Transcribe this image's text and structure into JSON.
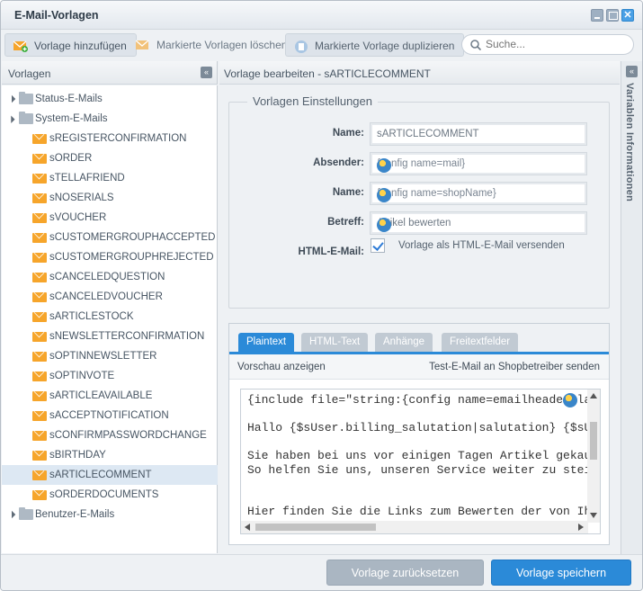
{
  "window": {
    "title": "E-Mail-Vorlagen"
  },
  "toolbar": {
    "add_label": "Vorlage hinzufügen",
    "delete_label": "Markierte Vorlagen löschen",
    "duplicate_label": "Markierte Vorlage duplizieren",
    "search_placeholder": "Suche..."
  },
  "left_panel": {
    "title": "Vorlagen",
    "folders": {
      "status": "Status-E-Mails",
      "system": "System-E-Mails",
      "user": "Benutzer-E-Mails"
    },
    "items": [
      "sREGISTERCONFIRMATION",
      "sORDER",
      "sTELLAFRIEND",
      "sNOSERIALS",
      "sVOUCHER",
      "sCUSTOMERGROUPHACCEPTED",
      "sCUSTOMERGROUPHREJECTED",
      "sCANCELEDQUESTION",
      "sCANCELEDVOUCHER",
      "sARTICLESTOCK",
      "sNEWSLETTERCONFIRMATION",
      "sOPTINNEWSLETTER",
      "sOPTINVOTE",
      "sARTICLEAVAILABLE",
      "sACCEPTNOTIFICATION",
      "sCONFIRMPASSWORDCHANGE",
      "sBIRTHDAY",
      "sARTICLECOMMENT",
      "sORDERDOCUMENTS"
    ],
    "selected": "sARTICLECOMMENT"
  },
  "editor": {
    "title": "Vorlage bearbeiten - sARTICLECOMMENT",
    "settings_legend": "Vorlagen Einstellungen",
    "fields": {
      "name_label": "Name:",
      "name_value": "sARTICLECOMMENT",
      "sender_label": "Absender:",
      "sender_value": "{config name=mail}",
      "sender_name_label": "Name:",
      "sender_name_value": "{config name=shopName}",
      "subject_label": "Betreff:",
      "subject_value": "Artikel bewerten",
      "html_label": "HTML-E-Mail:",
      "html_checkbox_label": "Vorlage als HTML-E-Mail versenden",
      "html_checked": true
    },
    "tabs": [
      "Plaintext",
      "HTML-Text",
      "Anhänge",
      "Freitextfelder"
    ],
    "active_tab": "Plaintext",
    "preview_label": "Vorschau anzeigen",
    "test_mail_label": "Test-E-Mail an Shopbetreiber senden",
    "code_lines": [
      "{include file=\"string:{config name=emailheaderpla",
      "",
      "Hallo {$sUser.billing_salutation|salutation} {$sUser",
      "",
      "Sie haben bei uns vor einigen Tagen Artikel gekauft.",
      "So helfen Sie uns, unseren Service weiter zu steigern",
      "",
      "",
      "Hier finden Sie die Links zum Bewerten der von Ihnen"
    ]
  },
  "sidebar": {
    "label": "Variablen Informationen"
  },
  "footer": {
    "reset_label": "Vorlage zurücksetzen",
    "save_label": "Vorlage speichern"
  }
}
